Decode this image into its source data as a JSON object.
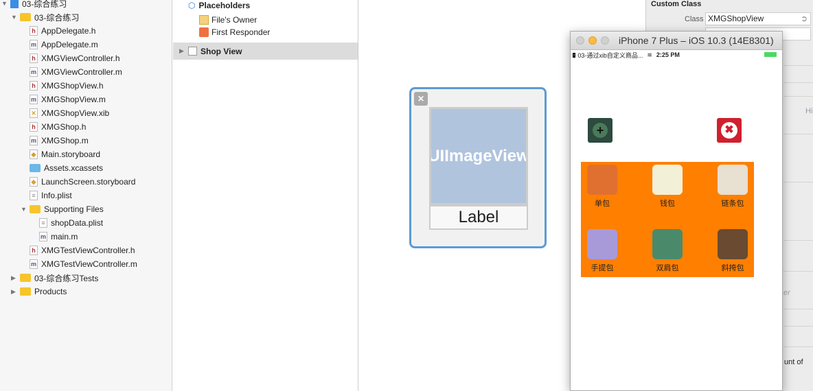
{
  "navigator": {
    "items": [
      {
        "label": "03-综合练习",
        "type": "project",
        "level": 0,
        "tri": "▼"
      },
      {
        "label": "03-综合练习",
        "type": "folder",
        "level": 1,
        "tri": "▼"
      },
      {
        "label": "AppDelegate.h",
        "type": "h",
        "level": 2
      },
      {
        "label": "AppDelegate.m",
        "type": "m",
        "level": 2
      },
      {
        "label": "XMGViewController.h",
        "type": "h",
        "level": 2
      },
      {
        "label": "XMGViewController.m",
        "type": "m",
        "level": 2
      },
      {
        "label": "XMGShopView.h",
        "type": "h",
        "level": 2
      },
      {
        "label": "XMGShopView.m",
        "type": "m",
        "level": 2
      },
      {
        "label": "XMGShopView.xib",
        "type": "xib",
        "level": 2
      },
      {
        "label": "XMGShop.h",
        "type": "h",
        "level": 2
      },
      {
        "label": "XMGShop.m",
        "type": "m",
        "level": 2
      },
      {
        "label": "Main.storyboard",
        "type": "sb",
        "level": 2
      },
      {
        "label": "Assets.xcassets",
        "type": "assets",
        "level": 2
      },
      {
        "label": "LaunchScreen.storyboard",
        "type": "sb",
        "level": 2
      },
      {
        "label": "Info.plist",
        "type": "plist",
        "level": 2
      },
      {
        "label": "Supporting Files",
        "type": "folder",
        "level": 2,
        "tri": "▼"
      },
      {
        "label": "shopData.plist",
        "type": "plist",
        "level": 3
      },
      {
        "label": "main.m",
        "type": "m",
        "level": 3
      },
      {
        "label": "XMGTestViewController.h",
        "type": "h",
        "level": 2
      },
      {
        "label": "XMGTestViewController.m",
        "type": "m",
        "level": 2
      },
      {
        "label": "03-综合练习Tests",
        "type": "folder",
        "level": 1,
        "tri": "▶"
      },
      {
        "label": "Products",
        "type": "folder",
        "level": 1,
        "tri": "▶"
      }
    ]
  },
  "outline": {
    "placeholders": "Placeholders",
    "files_owner": "File's Owner",
    "first_responder": "First Responder",
    "shop_view": "Shop View"
  },
  "canvas": {
    "image_view": "UIImageView",
    "label": "Label"
  },
  "inspector": {
    "section": "Custom Class",
    "class_label": "Class",
    "class_value": "XMGShopView",
    "hint": "Hi",
    "partial": "unt of",
    "placeholder_partial": "er"
  },
  "simulator": {
    "title": "iPhone 7 Plus – iOS 10.3 (14E8301)",
    "back_app": "03-通过xib自定义商品...",
    "time": "2:25 PM",
    "battery_color": "#4cd964",
    "products": [
      {
        "name": "单包",
        "color": "#e07030"
      },
      {
        "name": "钱包",
        "color": "#f3f0d8"
      },
      {
        "name": "链条包",
        "color": "#e8e0d0"
      },
      {
        "name": "手提包",
        "color": "#a89ad8"
      },
      {
        "name": "双肩包",
        "color": "#4a8a6a"
      },
      {
        "name": "斜挎包",
        "color": "#6a4a30"
      }
    ]
  }
}
